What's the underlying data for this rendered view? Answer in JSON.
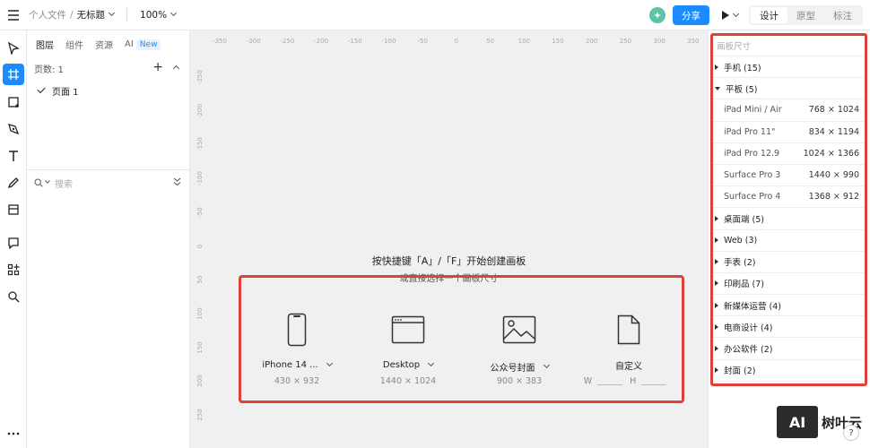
{
  "header": {
    "breadcrumb_parent": "个人文件",
    "breadcrumb_sep": "/",
    "file_title": "无标题",
    "zoom": "100%",
    "share_label": "分享",
    "mode_tabs": [
      "设计",
      "原型",
      "标注"
    ]
  },
  "left_panel": {
    "tabs": [
      "图层",
      "组件",
      "资源",
      "AI"
    ],
    "new_badge": "New",
    "pages_label": "页数: 1",
    "pages": [
      "页面 1"
    ],
    "search_placeholder": "搜索"
  },
  "canvas": {
    "ruler_x": [
      "-350",
      "-300",
      "-250",
      "-200",
      "-150",
      "-100",
      "-50",
      "0",
      "50",
      "100",
      "150",
      "200",
      "250",
      "300",
      "350"
    ],
    "ruler_y": [
      "-250",
      "-200",
      "-150",
      "-100",
      "-50",
      "0",
      "50",
      "100",
      "150",
      "200",
      "250"
    ],
    "hint_title": "按快捷键「A」/「F」开始创建画板",
    "hint_sub": "或直接选择一个画板尺寸",
    "presets": [
      {
        "name": "iPhone 14 ...",
        "size": "430 × 932",
        "icon": "phone-icon"
      },
      {
        "name": "Desktop",
        "size": "1440 × 1024",
        "icon": "desktop-icon"
      },
      {
        "name": "公众号封面",
        "size": "900 × 383",
        "icon": "image-icon"
      },
      {
        "name": "自定义",
        "icon": "file-icon"
      }
    ],
    "custom_w": "W",
    "custom_h": "H"
  },
  "right_panel": {
    "heading": "画板尺寸",
    "categories_before": [
      {
        "label": "手机 (15)"
      }
    ],
    "tablet": {
      "label": "平板 (5)"
    },
    "devices": [
      {
        "name": "iPad Mini / Air",
        "dim": "768 × 1024"
      },
      {
        "name": "iPad Pro 11\"",
        "dim": "834 × 1194"
      },
      {
        "name": "iPad Pro 12.9",
        "dim": "1024 × 1366"
      },
      {
        "name": "Surface Pro 3",
        "dim": "1440 × 990"
      },
      {
        "name": "Surface Pro 4",
        "dim": "1368 × 912"
      }
    ],
    "categories_after": [
      {
        "label": "桌面端 (5)"
      },
      {
        "label": "Web (3)"
      },
      {
        "label": "手表 (2)"
      },
      {
        "label": "印刷品 (7)"
      },
      {
        "label": "新媒体运营 (4)"
      },
      {
        "label": "电商设计 (4)"
      },
      {
        "label": "办公软件 (2)"
      },
      {
        "label": "封面 (2)"
      }
    ]
  },
  "watermark": {
    "logo": "AI",
    "text": "树叶云"
  },
  "help": "?",
  "colors": {
    "accent": "#1a8cff",
    "highlight": "#e0403a"
  }
}
